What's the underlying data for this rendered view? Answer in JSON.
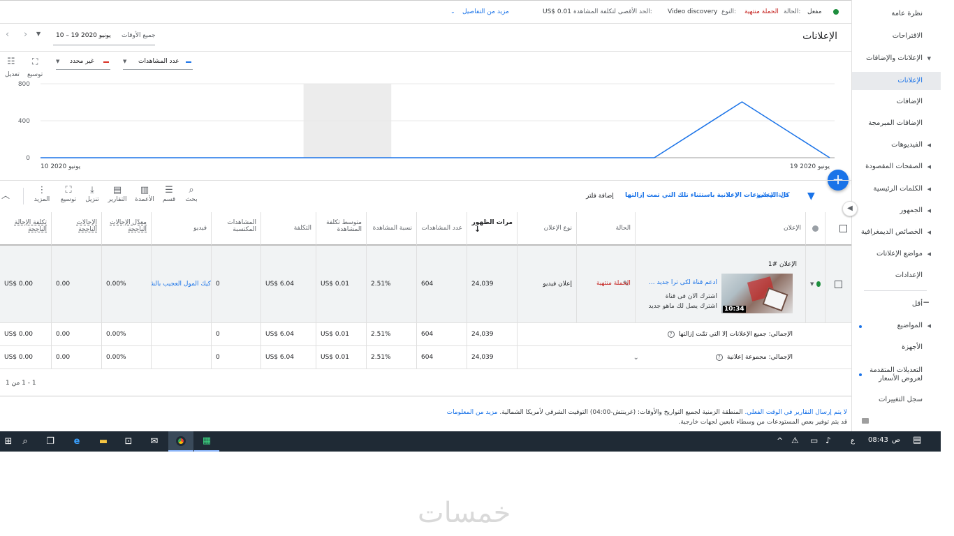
{
  "status": {
    "enabled": "مفعل",
    "state_label": "الحالة:",
    "state_value": "الحملة منتهية",
    "type_label": "النوع:",
    "type_value": "Video discovery",
    "max_cpv_label": "الحد الأقصى لتكلفة المشاهدة:",
    "max_cpv_value": "US$ 0.01",
    "more_details": "مزيد من التفاصيل"
  },
  "header": {
    "title": "الإعلانات",
    "date_label": "جميع الأوقات",
    "date_range": "10 – 19 يونيو 2020"
  },
  "sidebar": {
    "items": [
      {
        "label": "نظرة عامة",
        "top": 14
      },
      {
        "label": "الاقتراحات",
        "top": 46
      },
      {
        "label": "الإعلانات والإضافات",
        "top": 78
      },
      {
        "label": "الإعلانات",
        "top": 103
      },
      {
        "label": "الإضافات",
        "top": 140
      },
      {
        "label": "الإضافات المبرمجة",
        "top": 171
      },
      {
        "label": "الفيديوهات",
        "top": 202
      },
      {
        "label": "الصفحات المقصودة",
        "top": 233
      },
      {
        "label": "الكلمات الرئيسية",
        "top": 265
      },
      {
        "label": "الجمهور",
        "top": 296
      },
      {
        "label": "الخصائص الديمغرافية",
        "top": 327
      },
      {
        "label": "مواضع الإعلانات",
        "top": 358
      },
      {
        "label": "الإعدادات",
        "top": 389
      },
      {
        "label": "أقل",
        "top": 430
      },
      {
        "label": "المواضيع",
        "top": 461
      },
      {
        "label": "الأجهزة",
        "top": 492
      },
      {
        "label": "التعديلات المتقدمة",
        "top": 525
      },
      {
        "label": "لعروض الأسعار",
        "top": 537
      },
      {
        "label": "سجل التغييرات",
        "top": 567
      }
    ]
  },
  "chart_controls": {
    "metric1": "عدد المشاهدات",
    "metric2": "غير محدد",
    "expand": "توسيع",
    "adjust": "تعديل"
  },
  "chart_data": {
    "type": "line",
    "x": [
      "10 يونيو 2020",
      "11",
      "12",
      "13",
      "14",
      "15",
      "16",
      "17",
      "18",
      "19 يونيو 2020"
    ],
    "series": [
      {
        "name": "عدد المشاهدات",
        "values": [
          0,
          0,
          0,
          0,
          0,
          0,
          0,
          0,
          604,
          0
        ],
        "color": "#1a73e8"
      }
    ],
    "ylim": [
      0,
      800
    ],
    "yticks": [
      "800",
      "400",
      "0"
    ],
    "xtick_labels": [
      "10 يونيو 2020",
      "19 يونيو 2020"
    ],
    "grid": true,
    "shaded_range": [
      3,
      4
    ]
  },
  "filter": {
    "label": "حالة الإعلان:",
    "value": "كل المجموعات الإعلانية باستثناء تلك التي تمت إزالتها",
    "add": "إضافة فلتر"
  },
  "toolbar": {
    "search": "بحث",
    "segment": "قسم",
    "columns": "الأعمدة",
    "reports": "التقارير",
    "download": "تنزيل",
    "expand": "توسيع",
    "more": "المزيد"
  },
  "table": {
    "headers": {
      "ad": "الإعلان",
      "status": "الحالة",
      "ad_type": "نوع الإعلان",
      "impressions": "مرات الظهور",
      "views": "عدد المشاهدات",
      "view_rate": "نسبة المشاهدة",
      "avg_cpv": "متوسط تكلفة المشاهدة",
      "cost": "التكلفة",
      "earned_views": "المشاهدات المكتسبة",
      "video": "فيديو",
      "conv_rate": "معدّل الإحالات الناجحة",
      "conversions": "الإحالات الناجحة",
      "cost_per_conv": "تكلفة الإحالة الناجحة"
    },
    "ad_row": {
      "ad_number": "الإعلان #1",
      "headline": "ادعم قناة لكى ترا جديد ...",
      "desc1": "اشترك الان فى قناة",
      "desc2": "اشترك يصل لك ماهو جديد",
      "duration": "10:34",
      "status": "الحملة منتهية",
      "ad_type": "إعلان فيديو",
      "impressions": "24,039",
      "views": "604",
      "view_rate": "2.51%",
      "avg_cpv": "US$ 0.01",
      "cost": "US$ 6.04",
      "earned_views": "0",
      "video": "كيك المول العجيب بالشوكولاتة",
      "conv_rate": "0.00%",
      "conversions": "0.00",
      "cost_per_conv": "US$ 0.00"
    },
    "total1": {
      "label": "الإجمالي: جميع الإعلانات إلا التي تمّت إزالتها",
      "impressions": "24,039",
      "views": "604",
      "view_rate": "2.51%",
      "avg_cpv": "US$ 0.01",
      "cost": "US$ 6.04",
      "earned_views": "0",
      "conv_rate": "0.00%",
      "conversions": "0.00",
      "cost_per_conv": "US$ 0.00"
    },
    "total2": {
      "label": "الإجمالي: مجموعة إعلانية",
      "impressions": "24,039",
      "views": "604",
      "view_rate": "2.51%",
      "avg_cpv": "US$ 0.01",
      "cost": "US$ 6.04",
      "earned_views": "0",
      "conv_rate": "0.00%",
      "conversions": "0.00",
      "cost_per_conv": "US$ 0.00"
    },
    "pagination": "1 - 1 من 1"
  },
  "footer": {
    "line1_link": "لا يتم إرسال التقارير في الوقت الفعلي.",
    "line1_text": "المنطقة الزمنية لجميع التواريخ والأوقات: (غرينتش-04:00) التوقيت الشرقي لأمريكا الشمالية.",
    "line1_more": "مزيد من المعلومات",
    "line2": "قد يتم توفير بعض المستودعات من وسطاء تابعين لجهات خارجية."
  },
  "taskbar": {
    "time": "08:43",
    "ampm": "ص",
    "lang": "ع"
  },
  "watermark": "خمسات"
}
